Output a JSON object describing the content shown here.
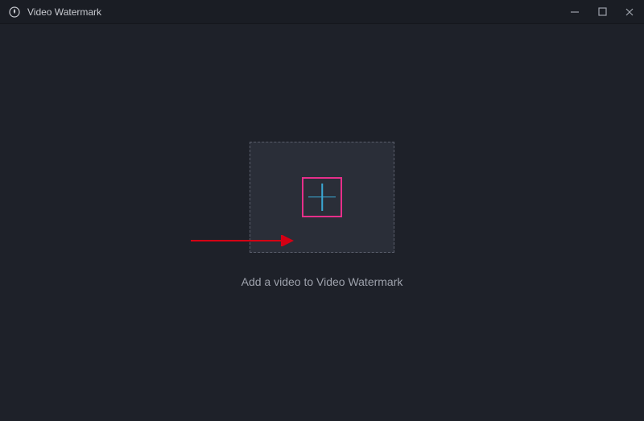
{
  "titlebar": {
    "app_title": "Video Watermark"
  },
  "main": {
    "help_text": "Add a video to Video Watermark"
  },
  "colors": {
    "accent_pink": "#e62f8a",
    "accent_blue": "#3aa8d4",
    "background": "#1e2129"
  }
}
